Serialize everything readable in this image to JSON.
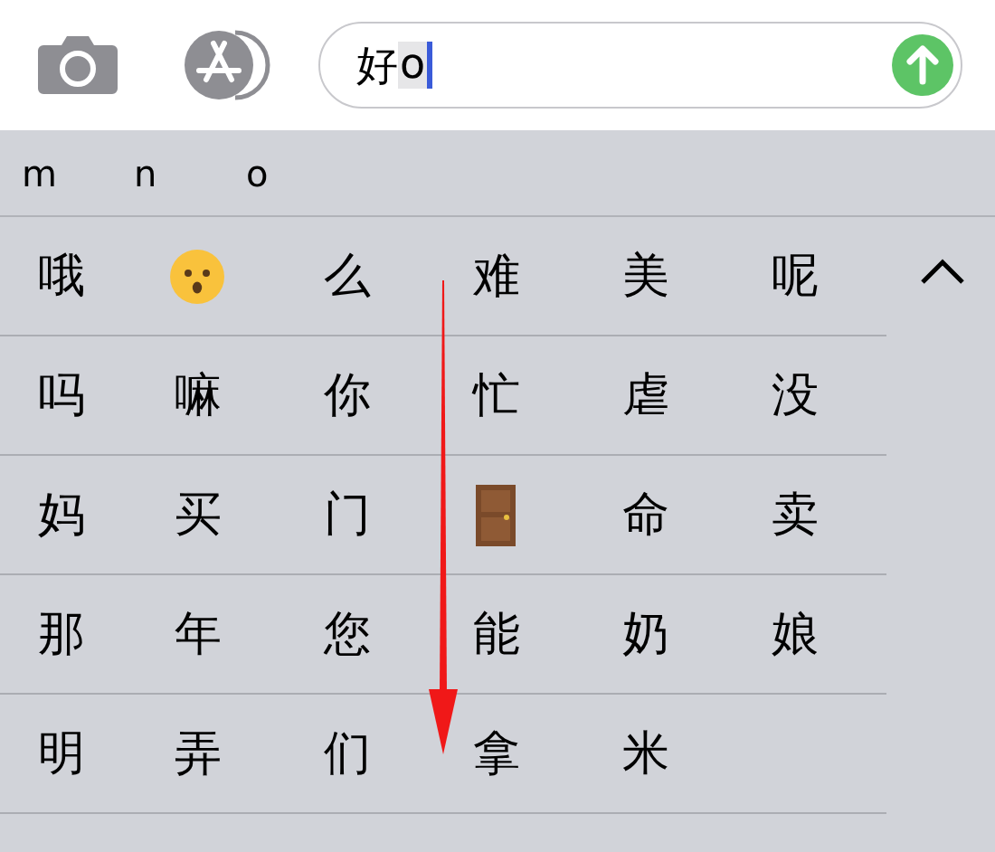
{
  "message_bar": {
    "input": {
      "value": "好",
      "marked_text": "o"
    }
  },
  "pinyin_options": [
    "m",
    "n",
    "o"
  ],
  "candidates": [
    [
      {
        "kind": "text",
        "text": "哦"
      },
      {
        "kind": "face"
      },
      {
        "kind": "text",
        "text": "么"
      },
      {
        "kind": "text",
        "text": "难"
      },
      {
        "kind": "text",
        "text": "美"
      },
      {
        "kind": "text",
        "text": "呢"
      }
    ],
    [
      {
        "kind": "text",
        "text": "吗"
      },
      {
        "kind": "text",
        "text": "嘛"
      },
      {
        "kind": "text",
        "text": "你"
      },
      {
        "kind": "text",
        "text": "忙"
      },
      {
        "kind": "text",
        "text": "虐"
      },
      {
        "kind": "text",
        "text": "没"
      }
    ],
    [
      {
        "kind": "text",
        "text": "妈"
      },
      {
        "kind": "text",
        "text": "买"
      },
      {
        "kind": "text",
        "text": "门"
      },
      {
        "kind": "door"
      },
      {
        "kind": "text",
        "text": "命"
      },
      {
        "kind": "text",
        "text": "卖"
      }
    ],
    [
      {
        "kind": "text",
        "text": "那"
      },
      {
        "kind": "text",
        "text": "年"
      },
      {
        "kind": "text",
        "text": "您"
      },
      {
        "kind": "text",
        "text": "能"
      },
      {
        "kind": "text",
        "text": "奶"
      },
      {
        "kind": "text",
        "text": "娘"
      }
    ],
    [
      {
        "kind": "text",
        "text": "明"
      },
      {
        "kind": "text",
        "text": "弄"
      },
      {
        "kind": "text",
        "text": "们"
      },
      {
        "kind": "text",
        "text": "拿"
      },
      {
        "kind": "text",
        "text": "米"
      }
    ]
  ]
}
